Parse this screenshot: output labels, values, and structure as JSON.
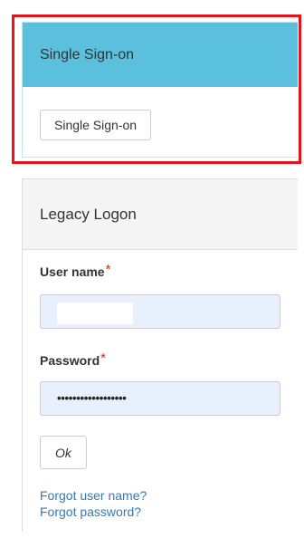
{
  "sso": {
    "heading": "Single Sign-on",
    "button_label": "Single Sign-on"
  },
  "legacy": {
    "heading": "Legacy Logon",
    "username_label": "User name",
    "password_label": "Password",
    "required_marker": "*",
    "username_value": "",
    "password_masked": "••••••••••••••••••",
    "ok_label": "Ok",
    "forgot_username": "Forgot user name?",
    "forgot_password": "Forgot password?"
  },
  "colors": {
    "sso_heading_bg": "#5bc0de",
    "highlight_border": "#e3141c",
    "input_bg": "#e8f0fe",
    "link": "#337ab7",
    "required": "#c9302c"
  }
}
